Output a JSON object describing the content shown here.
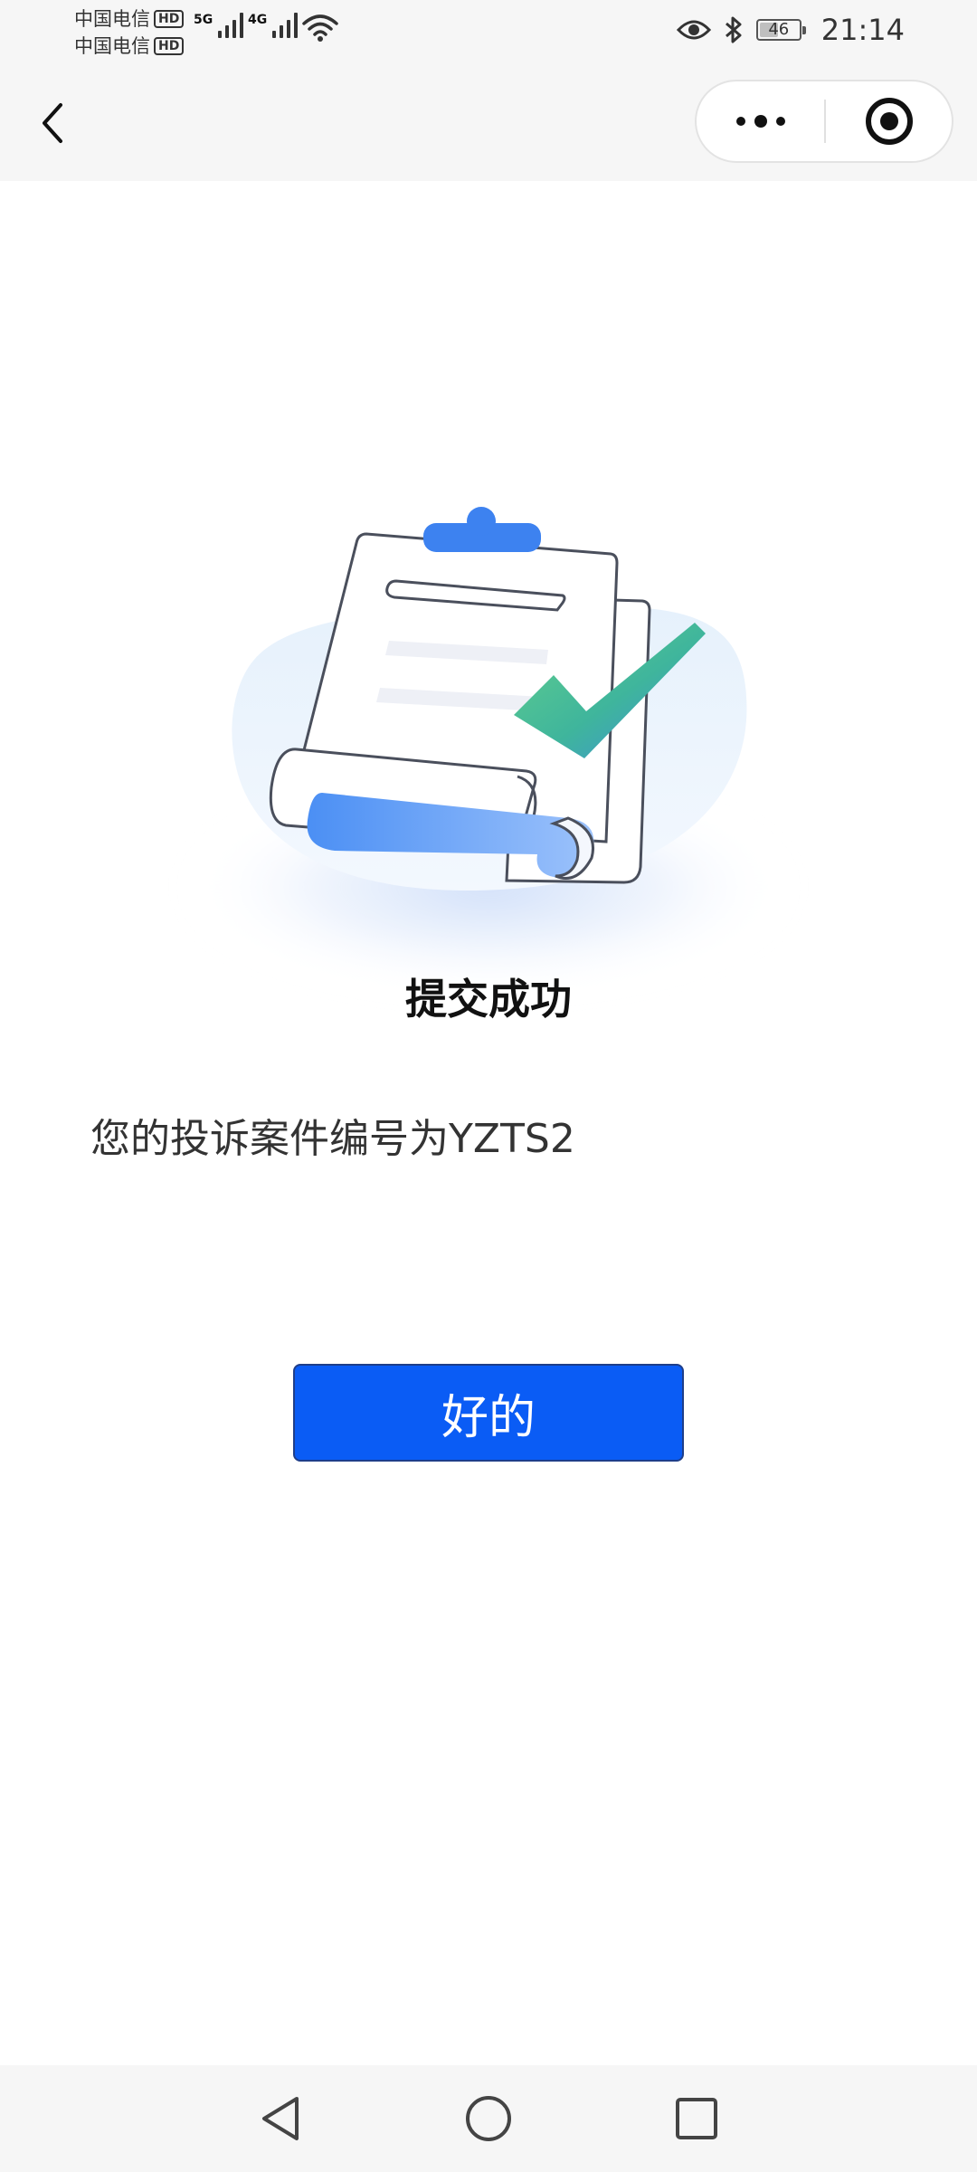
{
  "status_bar": {
    "carrier_1": "中国电信",
    "carrier_2": "中国电信",
    "hd_badge": "HD",
    "network_1": "5G",
    "network_2": "4G",
    "battery_level": "46",
    "time": "21:14",
    "icons": [
      "signal-icon",
      "wifi-icon",
      "eye-icon",
      "bluetooth-icon",
      "battery-icon"
    ]
  },
  "nav_bar": {
    "icons": [
      "back-arrow-icon",
      "more-dots-icon",
      "close-target-icon"
    ]
  },
  "content": {
    "illustration_icon": "clipboard-checkmark-illustration",
    "title": "提交成功",
    "case_number_text": "您的投诉案件编号为YZTS2",
    "ok_button_label": "好的"
  },
  "colors": {
    "primary_button": "#0a5cf5",
    "check_green": "#4fc384",
    "illustration_blue": "#3f86f2"
  },
  "system_nav": {
    "icons": [
      "back-triangle-icon",
      "home-circle-icon",
      "recents-square-icon"
    ]
  }
}
